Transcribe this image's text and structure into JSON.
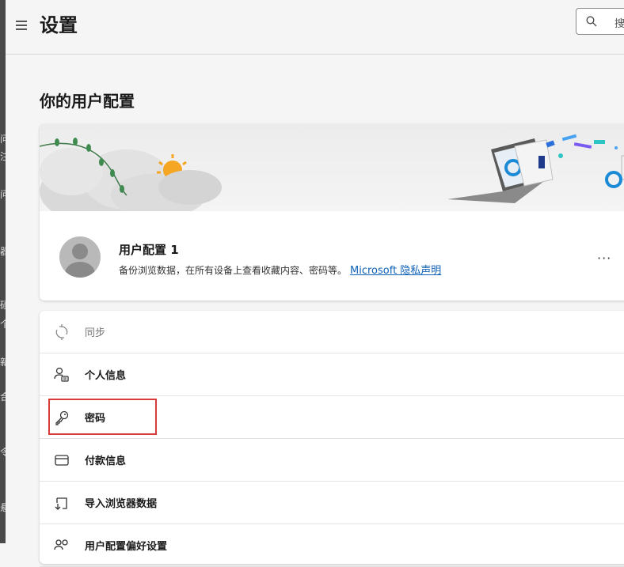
{
  "header": {
    "title": "设置",
    "search_placeholder": "搜"
  },
  "profile_section": {
    "title": "你的用户配置"
  },
  "profile": {
    "name": "用户配置 1",
    "description": "备份浏览数据，在所有设备上查看收藏内容、密码等。",
    "privacy_link": "Microsoft 隐私声明",
    "more_label": "···"
  },
  "menu": {
    "items": [
      {
        "label": "同步",
        "icon": "sync-icon",
        "disabled": true
      },
      {
        "label": "个人信息",
        "icon": "personal-info-icon",
        "disabled": false
      },
      {
        "label": "密码",
        "icon": "key-icon",
        "disabled": false,
        "highlighted": true
      },
      {
        "label": "付款信息",
        "icon": "card-icon",
        "disabled": false
      },
      {
        "label": "导入浏览器数据",
        "icon": "import-icon",
        "disabled": false
      },
      {
        "label": "用户配置偏好设置",
        "icon": "profile-prefs-icon",
        "disabled": false
      }
    ]
  },
  "edge_glyphs": [
    "问",
    "注",
    "问",
    "器",
    "硕",
    "个",
    "新",
    "合",
    "令",
    "悬"
  ],
  "colors": {
    "link": "#0f62b8",
    "highlight": "#d93a3a",
    "background": "#f5f5f5"
  }
}
